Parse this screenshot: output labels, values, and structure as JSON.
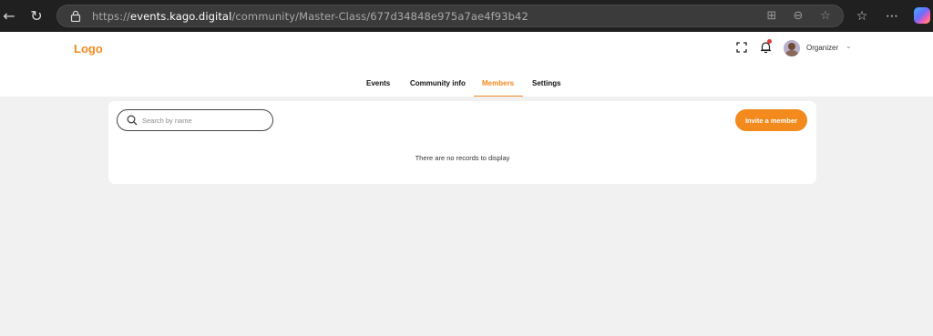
{
  "browser": {
    "url_scheme": "https://",
    "url_host": "events.kago.digital",
    "url_path": "/community/Master-Class/677d34848e975a7ae4f93b42"
  },
  "header": {
    "logo": "Logo",
    "user_name": "Organizer",
    "notification_badge_color": "#e23a3a"
  },
  "tabs": [
    {
      "label": "Events",
      "active": false
    },
    {
      "label": "Community info",
      "active": false
    },
    {
      "label": "Members",
      "active": true
    },
    {
      "label": "Settings",
      "active": false
    }
  ],
  "members": {
    "search_placeholder": "Search by name",
    "search_value": "",
    "invite_label": "Invite a member",
    "empty_message": "There are no records to display"
  },
  "colors": {
    "accent": "#f28a1e",
    "page_background": "#f1f1f1",
    "card_background": "#ffffff"
  }
}
